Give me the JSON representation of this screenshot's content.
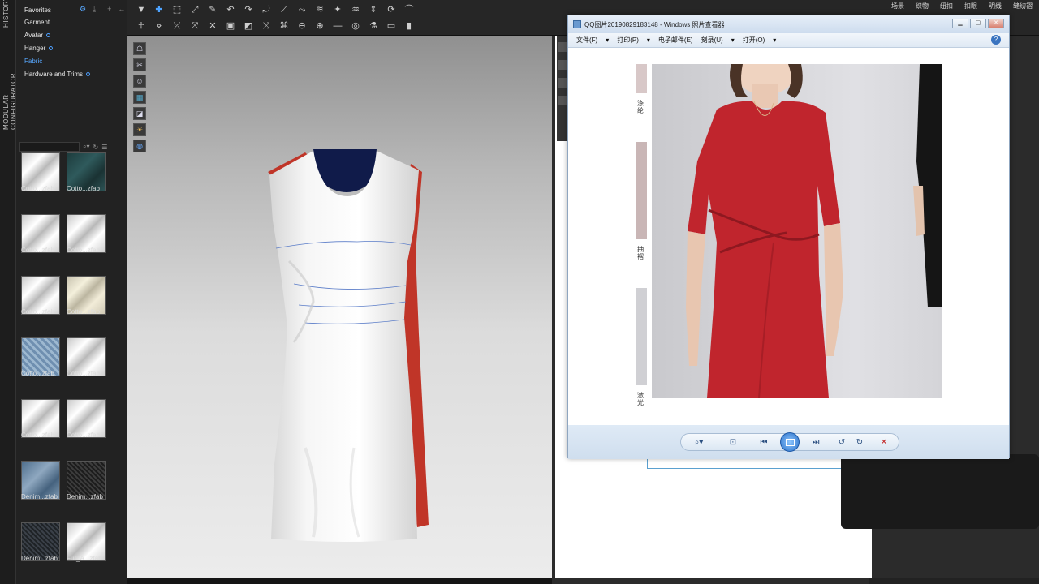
{
  "vertical_tabs": {
    "history": "HISTORY",
    "modular": "MODULAR CONFIGURATOR"
  },
  "library": {
    "items": [
      {
        "label": "Favorites"
      },
      {
        "label": "Garment"
      },
      {
        "label": "Avatar"
      },
      {
        "label": "Hanger"
      },
      {
        "label": "Fabric"
      },
      {
        "label": "Hardware and Trims"
      }
    ],
    "thumbnails": [
      {
        "label": "Cotto...zfab",
        "fabric": "white"
      },
      {
        "label": "Cotto...zfab",
        "fabric": "teal"
      },
      {
        "label": "Cotto...zfab",
        "fabric": "white"
      },
      {
        "label": "Cotto...zfab",
        "fabric": "white"
      },
      {
        "label": "Cotto...zfab",
        "fabric": "white"
      },
      {
        "label": "Cotto...zfab",
        "fabric": "cream"
      },
      {
        "label": "Cotto...zfab",
        "fabric": "blue-pattern"
      },
      {
        "label": "Cotto...zfab",
        "fabric": "white"
      },
      {
        "label": "Cotto...zfab",
        "fabric": "white"
      },
      {
        "label": "Cotto...zfab",
        "fabric": "white"
      },
      {
        "label": "Denim...zfab",
        "fabric": "denim-light"
      },
      {
        "label": "Denim...zfab",
        "fabric": "denim-dark"
      },
      {
        "label": "Denim...zfab",
        "fabric": "denim-black"
      },
      {
        "label": "Fur_A...zfab",
        "fabric": "white"
      }
    ]
  },
  "top_menu": [
    "场景",
    "织物",
    "纽扣",
    "扣眼",
    "明线",
    "缝纫褶"
  ],
  "photo_viewer": {
    "title": "QQ图片20190829183148 - Windows 照片查看器",
    "menu": [
      "文件(F)",
      "打印(P)",
      "电子邮件(E)",
      "刻录(U)",
      "打开(O)"
    ],
    "help": "?",
    "strip_text": [
      "涤纶",
      "抽褶",
      "激光"
    ]
  },
  "colors": {
    "accent": "#4da3ff",
    "dress_red": "#c02a32",
    "dress_white": "#f4f4f4"
  }
}
